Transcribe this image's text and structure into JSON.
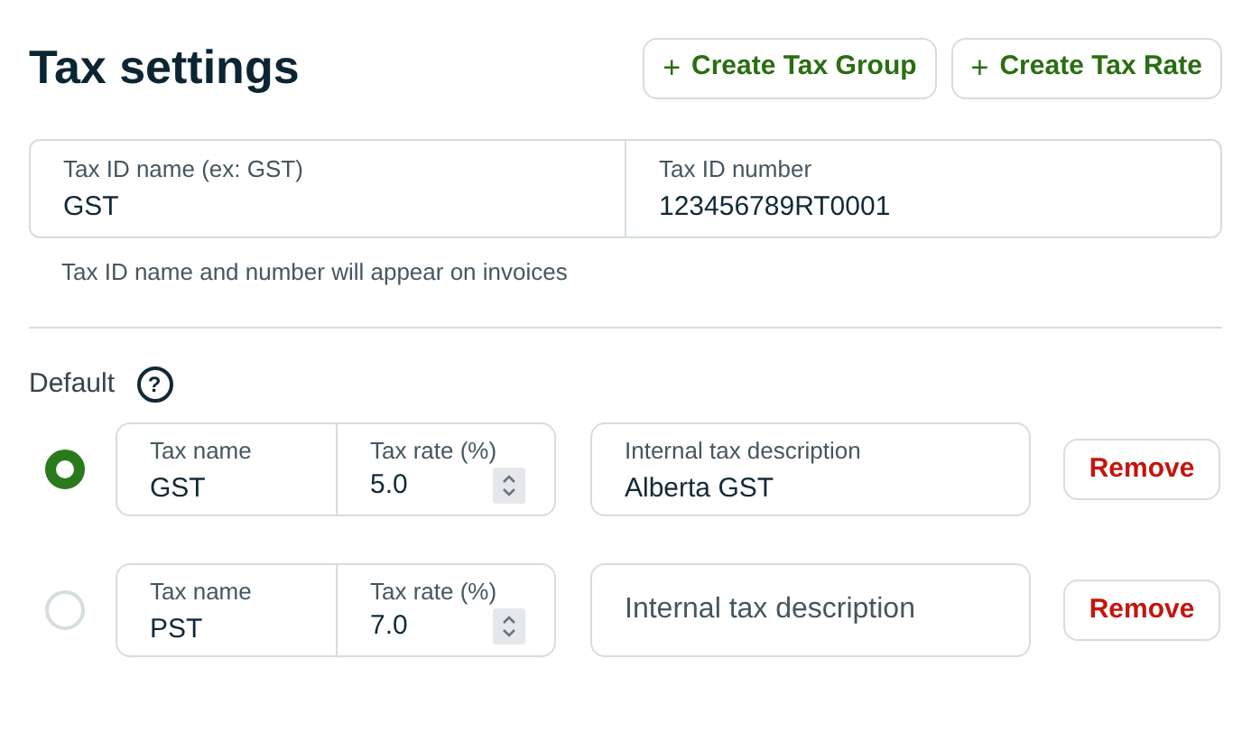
{
  "title": "Tax settings",
  "header_buttons": [
    {
      "icon": "+",
      "label": "Create Tax Group"
    },
    {
      "icon": "+",
      "label": "Create Tax Rate"
    }
  ],
  "tax_id": {
    "name": {
      "label": "Tax ID name (ex: GST)",
      "value": "GST"
    },
    "number": {
      "label": "Tax ID number",
      "value": "123456789RT0001"
    },
    "helper": "Tax ID name and number will appear on invoices"
  },
  "default_label": "Default",
  "default_help_icon": "?",
  "rates": [
    {
      "selected": true,
      "tax_name": {
        "label": "Tax name",
        "value": "GST"
      },
      "tax_rate": {
        "label": "Tax rate (%)",
        "value": "5.0"
      },
      "description": {
        "label": "Internal tax description",
        "value": "Alberta GST"
      },
      "remove": "Remove"
    },
    {
      "selected": false,
      "tax_name": {
        "label": "Tax name",
        "value": "PST"
      },
      "tax_rate": {
        "label": "Tax rate (%)",
        "value": "7.0"
      },
      "description": {
        "placeholder": "Internal tax description"
      },
      "remove": "Remove"
    }
  ]
}
